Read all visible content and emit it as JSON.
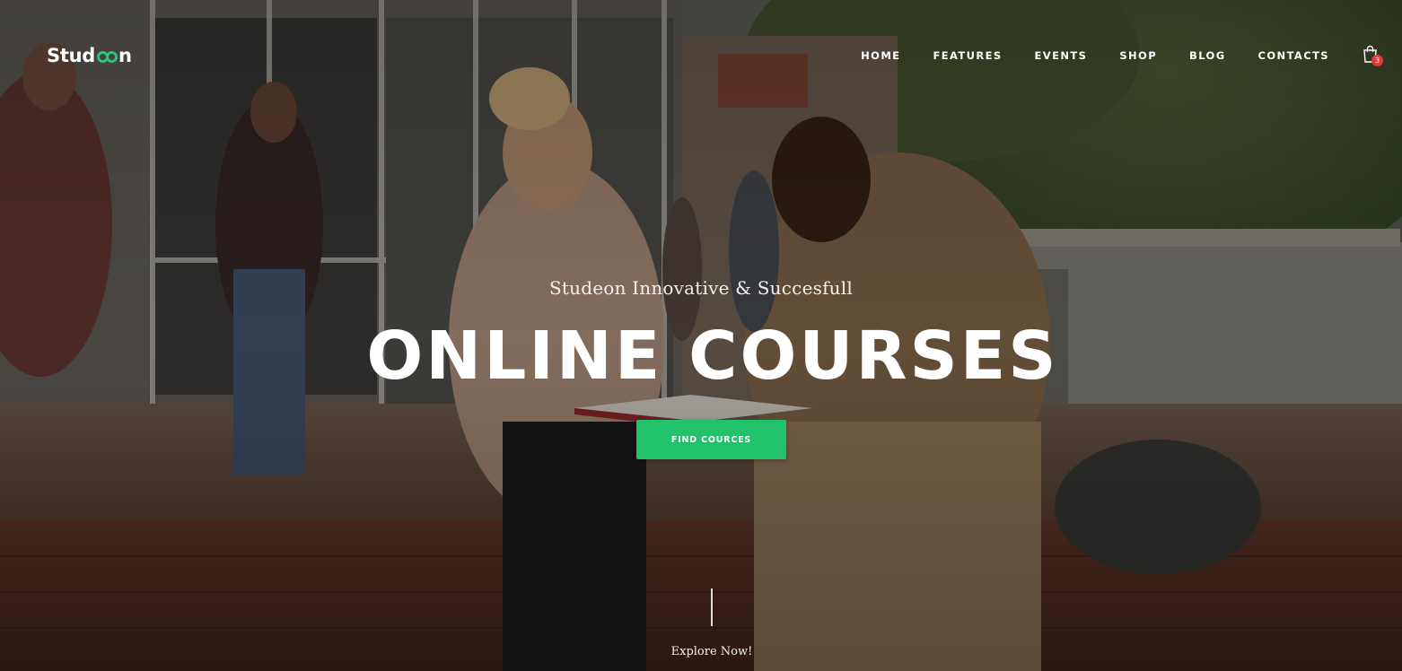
{
  "header": {
    "logo_prefix": "Stud",
    "logo_suffix": "n",
    "nav": [
      "HOME",
      "FEATURES",
      "EVENTS",
      "SHOP",
      "BLOG",
      "CONTACTS"
    ],
    "cart_count": "3"
  },
  "hero": {
    "subtitle": "Studeon Innovative & Succesfull",
    "title": "ONLINE COURSES",
    "cta_label": "FIND COURCES",
    "explore_label": "Explore Now!"
  },
  "colors": {
    "accent": "#22c26b",
    "badge": "#e23b3b"
  },
  "icons": [
    "logo-mark-icon",
    "shopping-bag-icon",
    "scroll-indicator-line"
  ]
}
